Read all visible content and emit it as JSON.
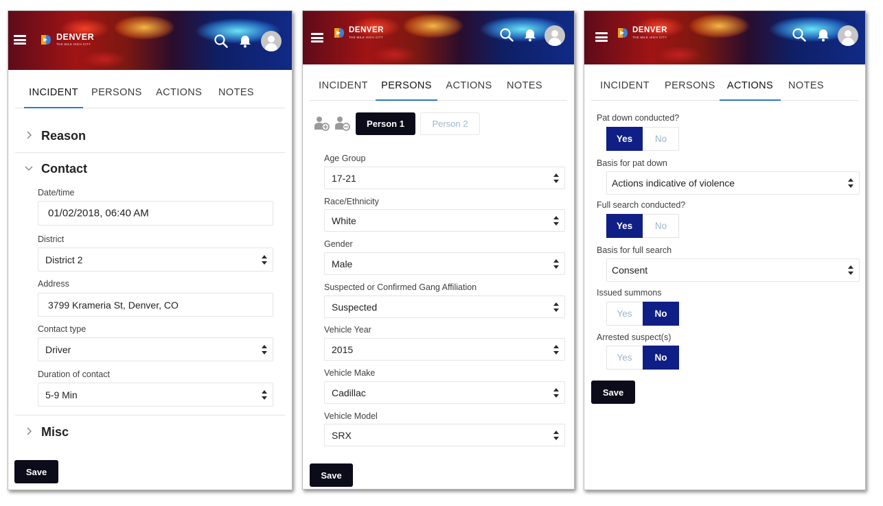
{
  "brand": {
    "name": "DENVER",
    "tagline": "THE MILE HIGH CITY",
    "accent_color": "#0f1f85",
    "tab_indicator_color": "#2b7bbf",
    "dark_button_color": "#0b0b1a"
  },
  "tabs": [
    "INCIDENT",
    "PERSONS",
    "ACTIONS",
    "NOTES"
  ],
  "header_icons": [
    "menu-icon",
    "search-icon",
    "bell-icon",
    "user-avatar-icon"
  ],
  "save_label": "Save",
  "incident": {
    "active_tab": "INCIDENT",
    "sections": {
      "reason": "Reason",
      "contact": "Contact",
      "misc": "Misc"
    },
    "contact_fields": [
      {
        "label": "Date/time",
        "value": "01/02/2018, 06:40 AM",
        "kind": "input"
      },
      {
        "label": "District",
        "value": "District 2",
        "kind": "select"
      },
      {
        "label": "Address",
        "value": "3799 Krameria St, Denver, CO",
        "kind": "input"
      },
      {
        "label": "Contact type",
        "value": "Driver",
        "kind": "select"
      },
      {
        "label": "Duration of contact",
        "value": "5-9 Min",
        "kind": "select"
      }
    ]
  },
  "persons": {
    "active_tab": "PERSONS",
    "person_tabs": [
      "Person 1",
      "Person 2"
    ],
    "selected_person": "Person 1",
    "fields": [
      {
        "label": "Age Group",
        "value": "17-21"
      },
      {
        "label": "Race/Ethnicity",
        "value": "White"
      },
      {
        "label": "Gender",
        "value": "Male"
      },
      {
        "label": "Suspected or Confirmed Gang Affiliation",
        "value": "Suspected"
      },
      {
        "label": "Vehicle Year",
        "value": "2015"
      },
      {
        "label": "Vehicle Make",
        "value": "Cadillac"
      },
      {
        "label": "Vehicle Model",
        "value": "SRX"
      }
    ]
  },
  "actions": {
    "active_tab": "ACTIONS",
    "yes_label": "Yes",
    "no_label": "No",
    "pat_down": {
      "label": "Pat down conducted?",
      "value": "Yes"
    },
    "pat_down_basis": {
      "label": "Basis for pat down",
      "value": "Actions indicative of violence"
    },
    "full_search": {
      "label": "Full search conducted?",
      "value": "Yes"
    },
    "full_search_basis": {
      "label": "Basis for full search",
      "value": "Consent"
    },
    "summons": {
      "label": "Issued summons",
      "value": "No"
    },
    "arrested": {
      "label": "Arrested suspect(s)",
      "value": "No"
    }
  }
}
